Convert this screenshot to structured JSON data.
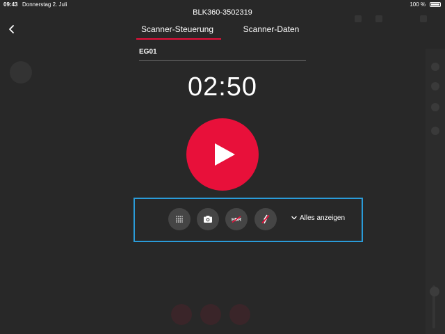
{
  "status_bar": {
    "time": "09:43",
    "date": "Donnerstag 2. Juli",
    "battery": "100 %"
  },
  "header": {
    "device_name": "BLK360-3502319",
    "tabs": [
      {
        "label": "Scanner-Steuerung",
        "active": true
      },
      {
        "label": "Scanner-Daten",
        "active": false
      }
    ]
  },
  "location": {
    "value": "EG01"
  },
  "timer": {
    "value": "02:50"
  },
  "options": {
    "buttons": [
      {
        "name": "density-button",
        "icon": "grid-dots-icon"
      },
      {
        "name": "camera-button",
        "icon": "camera-icon"
      },
      {
        "name": "hdr-button",
        "icon": "hdr-off-icon",
        "label": "HDR"
      },
      {
        "name": "thermal-button",
        "icon": "thermal-off-icon"
      }
    ],
    "show_all_label": "Alles anzeigen"
  },
  "colors": {
    "accent": "#e8103a",
    "highlight_border": "#2a9bd8",
    "background": "#282828"
  }
}
